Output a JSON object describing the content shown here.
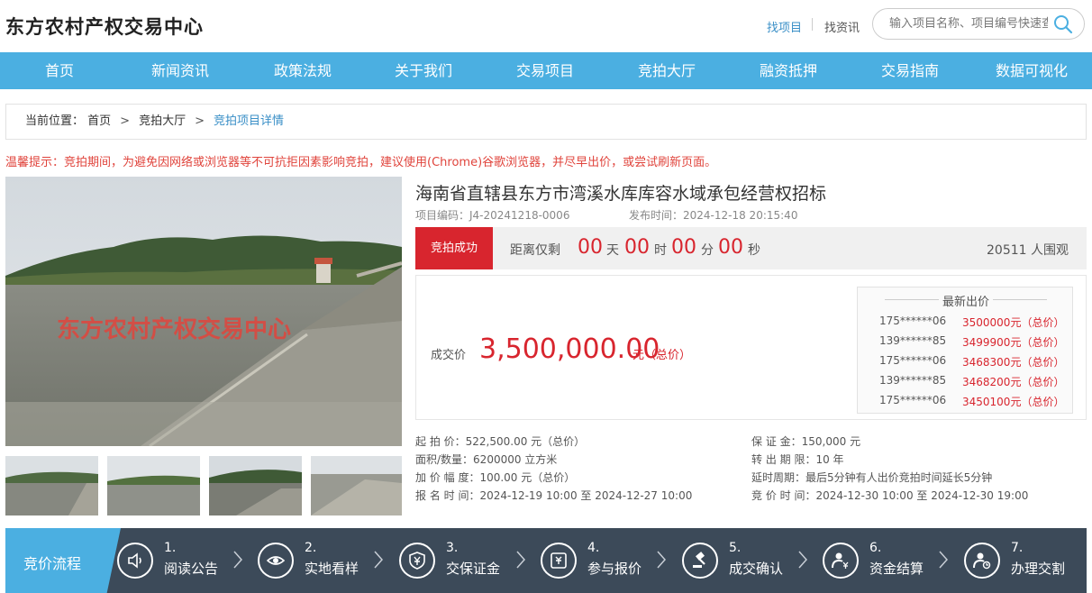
{
  "header": {
    "logo": "东方农村产权交易中心",
    "link_find_project": "找项目",
    "link_find_news": "找资讯",
    "search_placeholder": "输入项目名称、项目编号快速查找"
  },
  "nav": [
    "首页",
    "新闻资讯",
    "政策法规",
    "关于我们",
    "交易项目",
    "竞拍大厅",
    "融资抵押",
    "交易指南",
    "数据可视化"
  ],
  "breadcrumb": {
    "label": "当前位置：",
    "items": [
      "首页",
      "竞拍大厅",
      "竞拍项目详情"
    ]
  },
  "notice": "温馨提示：竞拍期间，为避免因网络或浏览器等不可抗拒因素影响竞拍，建议使用(Chrome)谷歌浏览器，并尽早出价，或尝试刷新页面。",
  "image": {
    "watermark": "东方农村产权交易中心"
  },
  "project": {
    "title": "海南省直辖县东方市湾溪水库库容水域承包经营权招标",
    "code": "项目编码：J4-20241218-0006",
    "publish": "发布时间：2024-12-18 20:15:40"
  },
  "status": {
    "badge": "竞拍成功",
    "remain_label": "距离仅剩",
    "days": "00",
    "days_unit": "天",
    "hours": "00",
    "hours_unit": "时",
    "minutes": "00",
    "minutes_unit": "分",
    "seconds": "00",
    "seconds_unit": "秒",
    "watchers": "20511 人围观"
  },
  "price": {
    "label": "成交价",
    "value": "3,500,000.00",
    "unit": "元（总价）"
  },
  "bids": {
    "title": "最新出价",
    "rows": [
      {
        "name": "175******06",
        "price": "3500000元（总价）"
      },
      {
        "name": "139******85",
        "price": "3499900元（总价）"
      },
      {
        "name": "175******06",
        "price": "3468300元（总价）"
      },
      {
        "name": "139******85",
        "price": "3468200元（总价）"
      },
      {
        "name": "175******06",
        "price": "3450100元（总价）"
      }
    ]
  },
  "info": {
    "start_price": "起  拍  价：522,500.00 元（总价）",
    "deposit": "保  证  金：150,000 元",
    "area": "面积/数量：6200000 立方米",
    "term": "转 出 期 限：10 年",
    "increment": "加 价 幅 度：100.00 元（总价）",
    "delay": "延时周期：最后5分钟有人出价竞拍时间延长5分钟",
    "signup": "报 名 时 间：2024-12-19 10:00 至 2024-12-27 10:00",
    "auction_time": "竞 价 时 间：2024-12-30 10:00 至 2024-12-30 19:00"
  },
  "flow": {
    "title": "竞价流程",
    "steps": [
      {
        "num": "1.",
        "label": "阅读公告",
        "icon": "speaker-icon"
      },
      {
        "num": "2.",
        "label": "实地看样",
        "icon": "eye-icon"
      },
      {
        "num": "3.",
        "label": "交保证金",
        "icon": "shield-yen-icon"
      },
      {
        "num": "4.",
        "label": "参与报价",
        "icon": "price-tag-icon"
      },
      {
        "num": "5.",
        "label": "成交确认",
        "icon": "gavel-icon"
      },
      {
        "num": "6.",
        "label": "资金结算",
        "icon": "user-money-icon"
      },
      {
        "num": "7.",
        "label": "办理交割",
        "icon": "user-transfer-icon"
      }
    ]
  }
}
